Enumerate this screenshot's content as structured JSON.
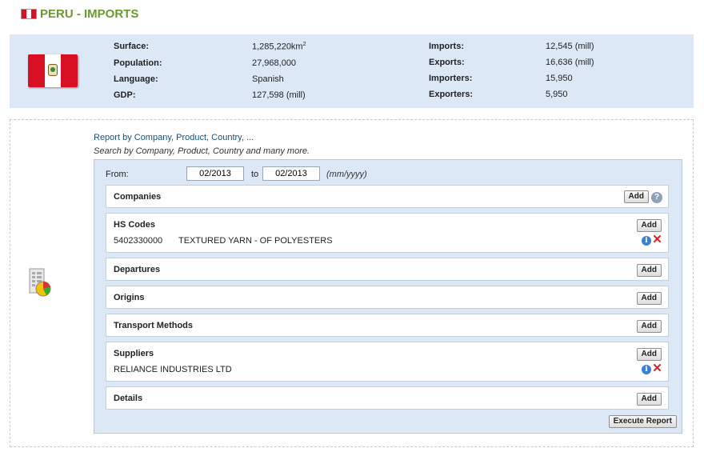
{
  "header": {
    "title": "PERU - IMPORTS",
    "flag_icon": "peru-flag-icon"
  },
  "country": {
    "flag_colors": {
      "red": "#d91023",
      "white": "#ffffff"
    },
    "stats_left": [
      {
        "label": "Surface:",
        "value": "1,285,220km",
        "sup": "2"
      },
      {
        "label": "Population:",
        "value": "27,968,000"
      },
      {
        "label": "Language:",
        "value": "Spanish"
      },
      {
        "label": "GDP:",
        "value": "127,598 (mill)"
      }
    ],
    "stats_right": [
      {
        "label": "Imports:",
        "value": "12,545 (mill)"
      },
      {
        "label": "Exports:",
        "value": "16,636 (mill)"
      },
      {
        "label": "Importers:",
        "value": "15,950"
      },
      {
        "label": "Exporters:",
        "value": "5,950"
      }
    ]
  },
  "report": {
    "title": "Report by Company, Product, Country, ...",
    "subtitle": "Search by Company, Product, Country and many more.",
    "from_label": "From:",
    "from_value": "02/2013",
    "to_label": "to",
    "to_value": "02/2013",
    "date_format": "(mm/yyyy)",
    "add_label": "Add",
    "execute_label": "Execute Report",
    "sections": [
      {
        "label": "Companies"
      },
      {
        "label": "HS Codes",
        "items": [
          {
            "code": "5402330000",
            "desc": "TEXTURED YARN - OF POLYESTERS"
          }
        ]
      },
      {
        "label": "Departures"
      },
      {
        "label": "Origins"
      },
      {
        "label": "Transport Methods"
      },
      {
        "label": "Suppliers",
        "items": [
          {
            "name": "RELIANCE INDUSTRIES LTD"
          }
        ]
      },
      {
        "label": "Details"
      }
    ]
  },
  "colors": {
    "accent_green": "#6c9a2e",
    "panel_blue": "#dde8f7",
    "link_blue": "#1b4f7a"
  }
}
